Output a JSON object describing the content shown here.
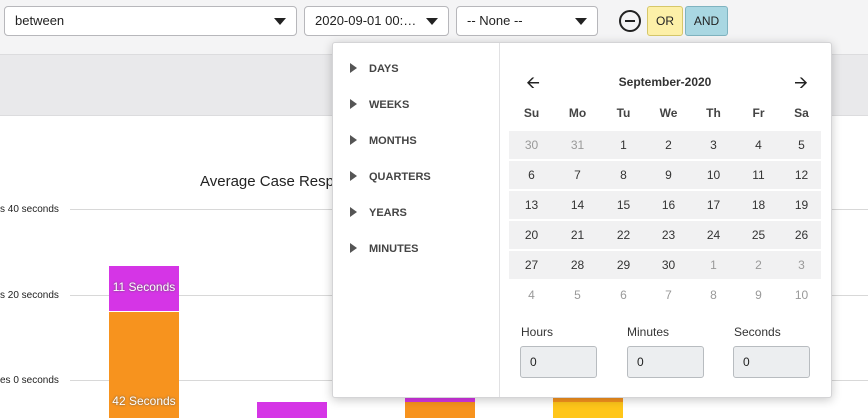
{
  "filter": {
    "operator": "between",
    "from_value": "2020-09-01 00:00...",
    "to_value": "-- None --",
    "or_label": "OR",
    "and_label": "AND"
  },
  "chart_data": {
    "type": "bar",
    "title": "Average Case Respo",
    "ytick_labels": [
      "s 40 seconds",
      "s 20 seconds",
      "es 0 seconds"
    ],
    "series": [
      {
        "name": "",
        "color": "#d535e6",
        "values": [
          11,
          null,
          null,
          null
        ]
      },
      {
        "name": "",
        "color": "#f7931e",
        "values": [
          42,
          null,
          null,
          null
        ]
      }
    ],
    "data_labels": [
      "11 Seconds",
      "42 Seconds"
    ]
  },
  "datepicker": {
    "shortcuts": [
      "DAYS",
      "WEEKS",
      "MONTHS",
      "QUARTERS",
      "YEARS",
      "MINUTES"
    ],
    "month_label": "September-2020",
    "prev_icon": "arrow-left-icon",
    "next_icon": "arrow-right-icon",
    "weekdays": [
      "Su",
      "Mo",
      "Tu",
      "We",
      "Th",
      "Fr",
      "Sa"
    ],
    "weeks": [
      [
        "30",
        "31",
        "1",
        "2",
        "3",
        "4",
        "5"
      ],
      [
        "6",
        "7",
        "8",
        "9",
        "10",
        "11",
        "12"
      ],
      [
        "13",
        "14",
        "15",
        "16",
        "17",
        "18",
        "19"
      ],
      [
        "20",
        "21",
        "22",
        "23",
        "24",
        "25",
        "26"
      ],
      [
        "27",
        "28",
        "29",
        "30",
        "1",
        "2",
        "3"
      ],
      [
        "4",
        "5",
        "6",
        "7",
        "8",
        "9",
        "10"
      ]
    ],
    "hours_label": "Hours",
    "minutes_label": "Minutes",
    "seconds_label": "Seconds",
    "hours_value": "0",
    "minutes_value": "0",
    "seconds_value": "0"
  }
}
